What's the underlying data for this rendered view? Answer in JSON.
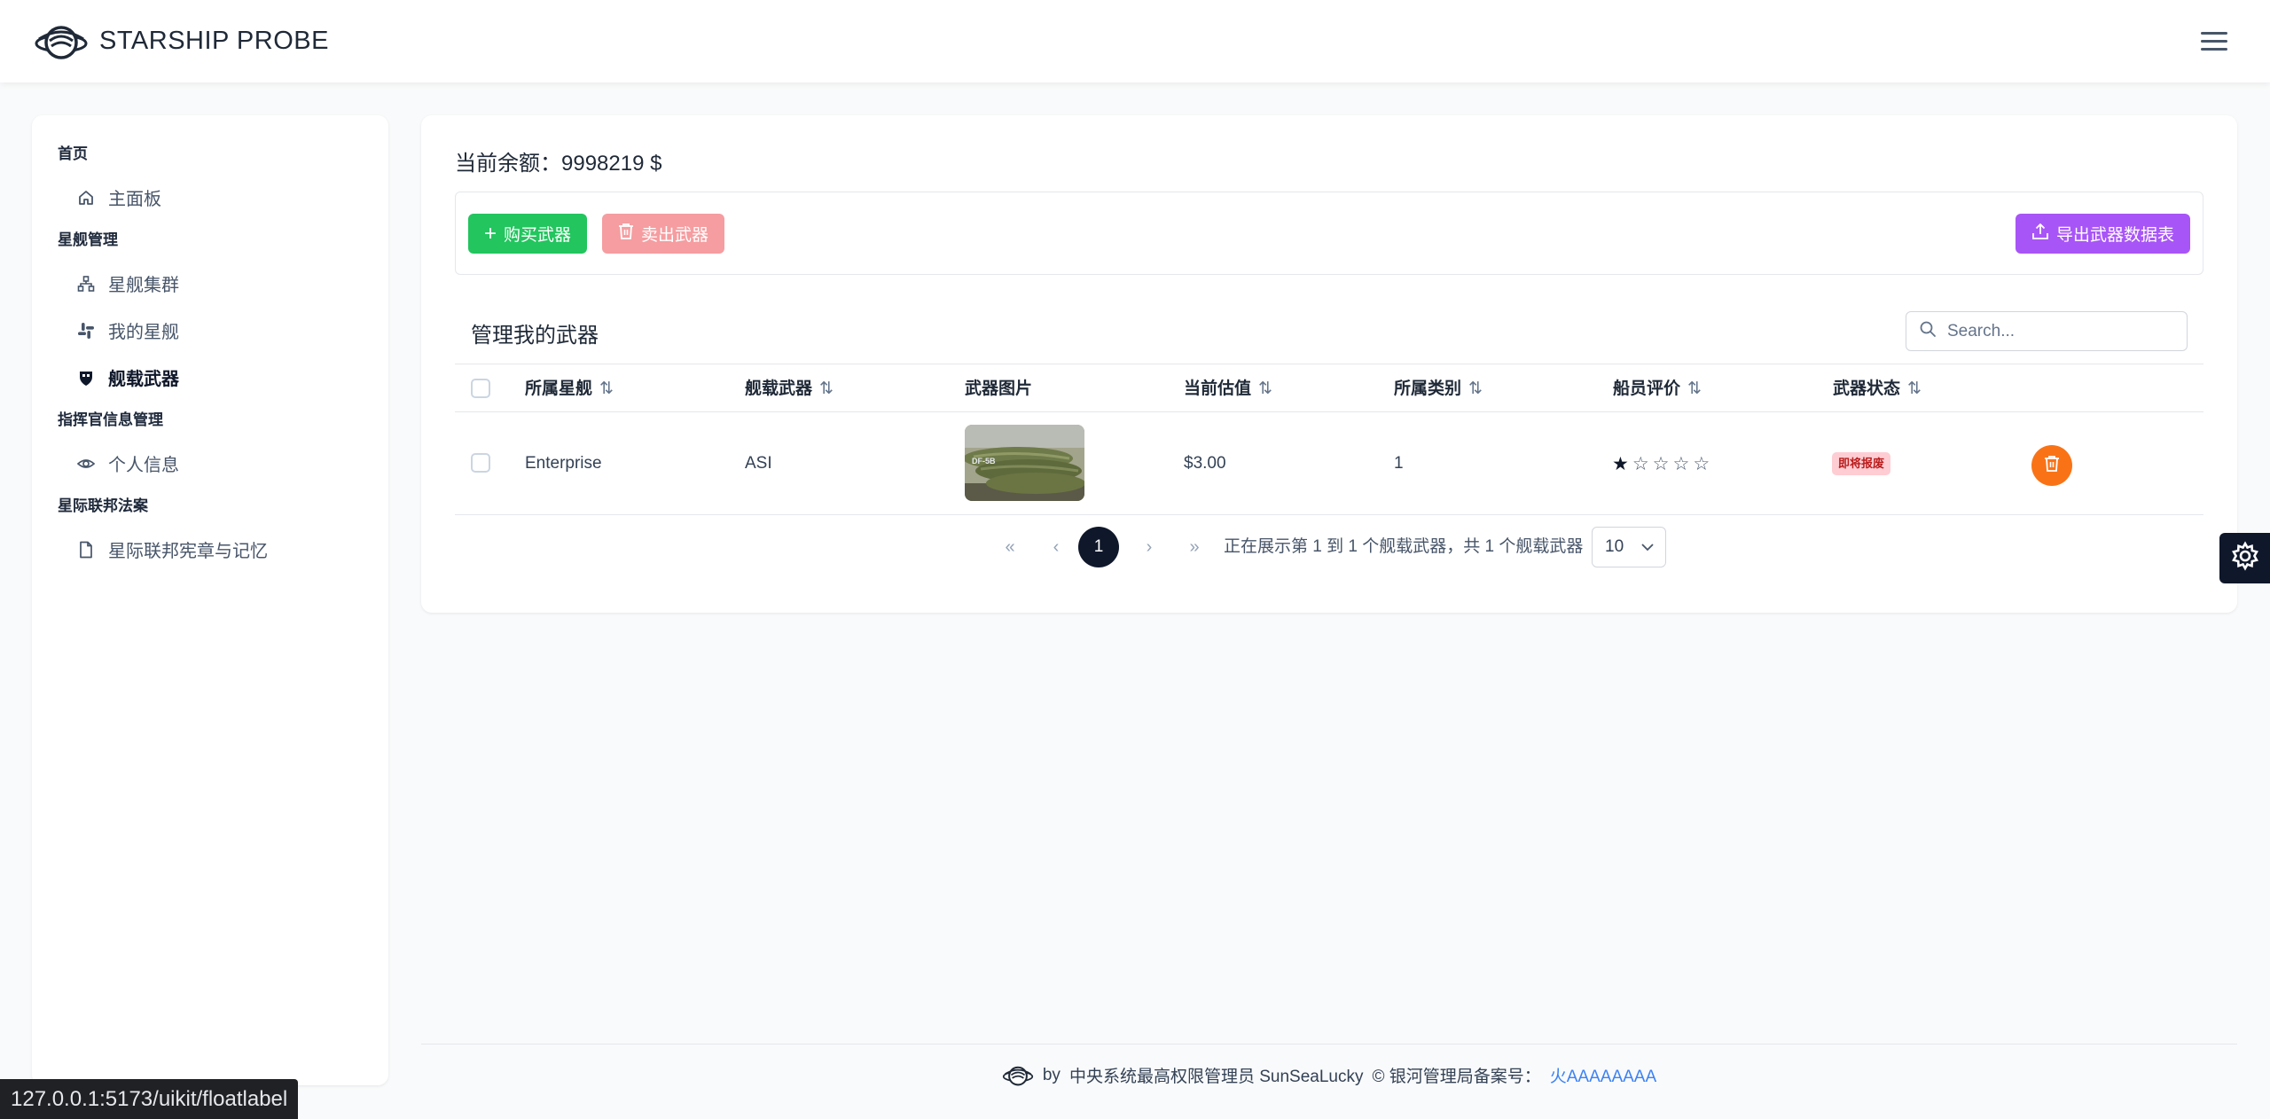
{
  "header": {
    "brand": "STARSHIP PROBE",
    "logo_icon": "starship-logo-icon",
    "menu_icon": "hamburger-menu-icon"
  },
  "sidebar": {
    "sections": [
      {
        "title": "首页",
        "items": [
          {
            "label": "主面板",
            "icon": "home-icon"
          }
        ]
      },
      {
        "title": "星舰管理",
        "items": [
          {
            "label": "星舰集群",
            "icon": "sitemap-icon"
          },
          {
            "label": "我的星舰",
            "icon": "slack-icon"
          },
          {
            "label": "舰载武器",
            "icon": "shield-icon",
            "active": true
          }
        ]
      },
      {
        "title": "指挥官信息管理",
        "items": [
          {
            "label": "个人信息",
            "icon": "eye-icon"
          }
        ]
      },
      {
        "title": "星际联邦法案",
        "items": [
          {
            "label": "星际联邦宪章与记忆",
            "icon": "file-icon"
          }
        ]
      }
    ]
  },
  "main": {
    "balance": "当前余额：9998219 $",
    "toolbar": {
      "buy_label": "购买武器",
      "sell_label": "卖出武器",
      "export_label": "导出武器数据表"
    },
    "table": {
      "title": "管理我的武器",
      "search_placeholder": "Search...",
      "columns": [
        "所属星舰",
        "舰载武器",
        "武器图片",
        "当前估值",
        "所属类别",
        "船员评价",
        "武器状态"
      ],
      "rows": [
        {
          "ship": "Enterprise",
          "weapon": "ASI",
          "image_caption": "DF-5B",
          "value": "$3.00",
          "category": "1",
          "rating": 1,
          "rating_max": 5,
          "status": "即将报废"
        }
      ]
    },
    "pagination": {
      "first": "«",
      "prev": "‹",
      "current": "1",
      "next": "›",
      "last": "»",
      "info": "正在展示第 1 到 1 个舰载武器，共 1 个舰载武器",
      "page_size": "10"
    }
  },
  "footer": {
    "by": "by",
    "admin": "中央系统最高权限管理员 SunSeaLucky",
    "record_label": "© 银河管理局备案号：",
    "record_link": "火AAAAAAAA"
  },
  "status_url": "127.0.0.1:5173/uikit/floatlabel",
  "colors": {
    "buy": "#22c55e",
    "sell": "#f59da0",
    "export": "#a855f7",
    "delete": "#f97316",
    "status_bg": "#fecdd3",
    "status_text": "#b91c1c",
    "pager_active": "#0f172a"
  }
}
